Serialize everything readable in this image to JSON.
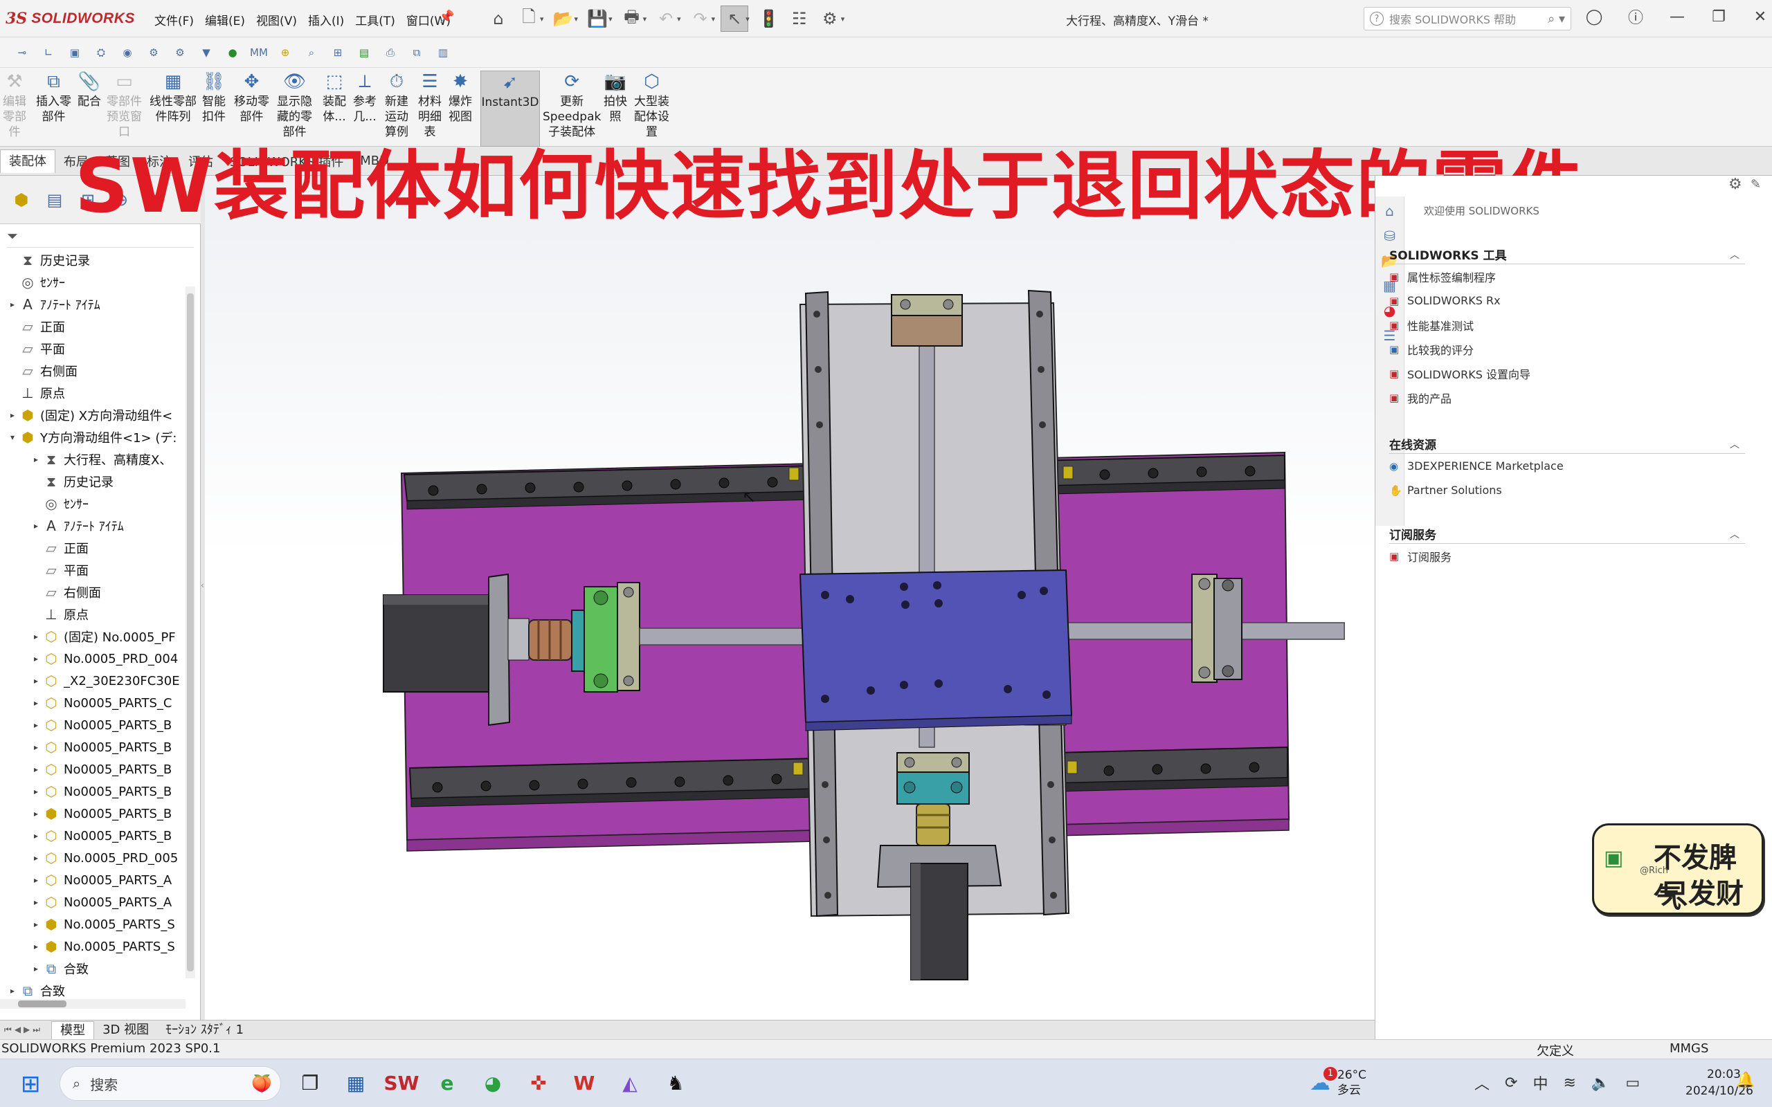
{
  "app": {
    "logo_ds": "3S",
    "logo_text": "SOLIDWORKS",
    "document_title": "大行程、高精度X、Y滑台 *",
    "help_placeholder": "搜索 SOLIDWORKS 帮助"
  },
  "menu": [
    "文件(F)",
    "编辑(E)",
    "视图(V)",
    "插入(I)",
    "工具(T)",
    "窗口(W)"
  ],
  "command_manager": [
    {
      "label": "编辑\n零部\n件",
      "icon": "edit-component-icon",
      "disabled": true
    },
    {
      "label": "插入零\n部件",
      "icon": "insert-component-icon"
    },
    {
      "label": "配合",
      "icon": "mate-icon"
    },
    {
      "label": "零部件\n预览窗\n口",
      "icon": "preview-window-icon",
      "disabled": true
    },
    {
      "label": "线性零部\n件阵列",
      "icon": "linear-pattern-icon"
    },
    {
      "label": "智能\n扣件",
      "icon": "smart-fastener-icon"
    },
    {
      "label": "移动零\n部件",
      "icon": "move-component-icon"
    },
    {
      "label": "显示隐\n藏的零\n部件",
      "icon": "show-hidden-icon"
    },
    {
      "label": "装配\n体...",
      "icon": "assembly-feature-icon"
    },
    {
      "label": "参考\n几...",
      "icon": "reference-geometry-icon"
    },
    {
      "label": "新建\n运动\n算例",
      "icon": "motion-study-icon"
    },
    {
      "label": "材料\n明细\n表",
      "icon": "bom-icon"
    },
    {
      "label": "爆炸\n视图",
      "icon": "exploded-view-icon"
    },
    {
      "label": "Instant3D",
      "icon": "instant3d-icon",
      "selected": true
    },
    {
      "label": "更新\nSpeedpak\n子装配体",
      "icon": "speedpak-icon"
    },
    {
      "label": "拍快\n照",
      "icon": "snapshot-icon"
    },
    {
      "label": "大型装\n配体设\n置",
      "icon": "large-assembly-icon"
    }
  ],
  "tabs": [
    "装配体",
    "布局",
    "草图",
    "标注",
    "评估",
    "SOLIDWORKS 插件",
    "MBD"
  ],
  "overlay_title": "SW装配体如何快速找到处于退回状态的零件",
  "tree": [
    {
      "label": "历史记录",
      "depth": 0,
      "icon": "history",
      "expand": ""
    },
    {
      "label": "ｾﾝｻｰ",
      "depth": 0,
      "icon": "sensor",
      "expand": ""
    },
    {
      "label": "ｱﾉﾃｰﾄ ｱｲﾃﾑ",
      "depth": 0,
      "icon": "annotation",
      "expand": "▸"
    },
    {
      "label": "正面",
      "depth": 0,
      "icon": "plane",
      "expand": ""
    },
    {
      "label": "平面",
      "depth": 0,
      "icon": "plane",
      "expand": ""
    },
    {
      "label": "右侧面",
      "depth": 0,
      "icon": "plane",
      "expand": ""
    },
    {
      "label": "原点",
      "depth": 0,
      "icon": "origin",
      "expand": ""
    },
    {
      "label": "(固定) X方向滑动组件<",
      "depth": 0,
      "icon": "subassembly",
      "expand": "▸"
    },
    {
      "label": "Y方向滑动组件<1> (デ:",
      "depth": 0,
      "icon": "subassembly",
      "expand": "▾"
    },
    {
      "label": "大行程、高精度X、",
      "depth": 1,
      "icon": "history",
      "expand": "▸"
    },
    {
      "label": "历史记录",
      "depth": 1,
      "icon": "history",
      "expand": ""
    },
    {
      "label": "ｾﾝｻｰ",
      "depth": 1,
      "icon": "sensor",
      "expand": ""
    },
    {
      "label": "ｱﾉﾃｰﾄ ｱｲﾃﾑ",
      "depth": 1,
      "icon": "annotation",
      "expand": "▸"
    },
    {
      "label": "正面",
      "depth": 1,
      "icon": "plane",
      "expand": ""
    },
    {
      "label": "平面",
      "depth": 1,
      "icon": "plane",
      "expand": ""
    },
    {
      "label": "右侧面",
      "depth": 1,
      "icon": "plane",
      "expand": ""
    },
    {
      "label": "原点",
      "depth": 1,
      "icon": "origin",
      "expand": ""
    },
    {
      "label": "(固定) No.0005_PF",
      "depth": 1,
      "icon": "part",
      "expand": "▸"
    },
    {
      "label": "No.0005_PRD_004",
      "depth": 1,
      "icon": "part",
      "expand": "▸"
    },
    {
      "label": "_X2_30E230FC30E",
      "depth": 1,
      "icon": "part",
      "expand": "▸"
    },
    {
      "label": "No0005_PARTS_C",
      "depth": 1,
      "icon": "part",
      "expand": "▸"
    },
    {
      "label": "No0005_PARTS_B",
      "depth": 1,
      "icon": "part",
      "expand": "▸"
    },
    {
      "label": "No0005_PARTS_B",
      "depth": 1,
      "icon": "part",
      "expand": "▸"
    },
    {
      "label": "No0005_PARTS_B",
      "depth": 1,
      "icon": "part",
      "expand": "▸"
    },
    {
      "label": "No0005_PARTS_B",
      "depth": 1,
      "icon": "part",
      "expand": "▸"
    },
    {
      "label": "No0005_PARTS_B",
      "depth": 1,
      "icon": "subassembly",
      "expand": "▸"
    },
    {
      "label": "No0005_PARTS_B",
      "depth": 1,
      "icon": "part",
      "expand": "▸"
    },
    {
      "label": "No.0005_PRD_005",
      "depth": 1,
      "icon": "part",
      "expand": "▸"
    },
    {
      "label": "No0005_PARTS_A",
      "depth": 1,
      "icon": "part",
      "expand": "▸"
    },
    {
      "label": "No0005_PARTS_A",
      "depth": 1,
      "icon": "part",
      "expand": "▸"
    },
    {
      "label": "No.0005_PARTS_S",
      "depth": 1,
      "icon": "subassembly",
      "expand": "▸"
    },
    {
      "label": "No.0005_PARTS_S",
      "depth": 1,
      "icon": "subassembly",
      "expand": "▸"
    },
    {
      "label": "合致",
      "depth": 1,
      "icon": "mate",
      "expand": "▸"
    },
    {
      "label": "合致",
      "depth": 0,
      "icon": "mate",
      "expand": "▸"
    }
  ],
  "bottom_tabs": [
    "模型",
    "3D 视图",
    "ﾓｰｼｮﾝ ｽﾀﾃﾞｨ 1"
  ],
  "status": {
    "left": "SOLIDWORKS Premium 2023 SP0.1",
    "under_defined": "欠定义",
    "units": "MMGS"
  },
  "task_pane": {
    "welcome": "欢迎使用 SOLIDWORKS",
    "sections": [
      {
        "title": "SOLIDWORKS 工具",
        "items": [
          {
            "label": "属性标签编制程序",
            "icon": "red"
          },
          {
            "label": "SOLIDWORKS Rx",
            "icon": "red"
          },
          {
            "label": "性能基准测试",
            "icon": "red"
          },
          {
            "label": "比较我的评分",
            "icon": "blue"
          },
          {
            "label": "SOLIDWORKS 设置向导",
            "icon": "red"
          },
          {
            "label": "我的产品",
            "icon": "red"
          }
        ]
      },
      {
        "title": "在线资源",
        "items": [
          {
            "label": "3DEXPERIENCE Marketplace",
            "icon": "blue"
          },
          {
            "label": "Partner Solutions",
            "icon": "gray"
          }
        ]
      },
      {
        "title": "订阅服务",
        "items": [
          {
            "label": "订阅服务",
            "icon": "red"
          }
        ]
      }
    ]
  },
  "sticker": {
    "line1": "不发脾气",
    "line2": "只发财",
    "tag": "@Rich"
  },
  "taskbar": {
    "search_placeholder": "搜索",
    "weather_temp": "26°C",
    "weather_desc": "多云",
    "weather_badge": "1",
    "time": "20:03",
    "date": "2024/10/26",
    "ime": "中"
  },
  "colors": {
    "accent_red": "#e01b24",
    "sw_red": "#c0282e",
    "magenta_plate": "#a23fa8",
    "blue_carriage": "#5253b4",
    "gray_plate": "#c8c8cc"
  }
}
